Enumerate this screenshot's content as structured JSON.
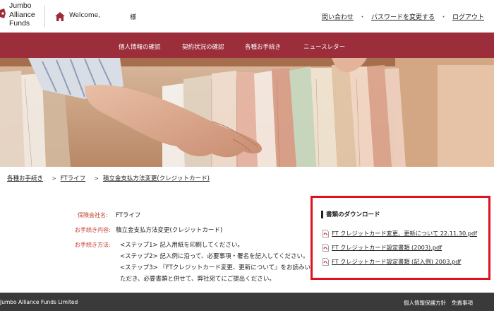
{
  "header": {
    "logo_lines": [
      "Jumbo",
      "Alliance",
      "Funds"
    ],
    "welcome": "Welcome,",
    "sama": "様",
    "links": {
      "contact": "問い合わせ",
      "password": "パスワードを変更する",
      "logout": "ログアウト",
      "separator": "・"
    }
  },
  "nav": {
    "items": [
      "個人情報の確認",
      "契約状況の確認",
      "各種お手続き",
      "ニュースレター"
    ]
  },
  "breadcrumb": {
    "items": [
      "各種お手続き",
      "FTライフ",
      "積立金支払方法変更(クレジットカード)"
    ],
    "chevron": ">"
  },
  "details": {
    "insurer_label": "保険会社名:",
    "insurer_value": "FTライフ",
    "procedure_label": "お手続き内容:",
    "procedure_value": "積立金支払方法変更(クレジットカード)",
    "method_label": "お手続き方法:",
    "method_lines": [
      "<ステップ1> 記入用紙を印刷してください。",
      "<ステップ2> 記入例に沿って、必要事項・署名を記入してください。",
      "<ステップ3> 『FTクレジットカード変更、更新について』をお読みい",
      "ただき、必要書類と併せて、弊社宛てにご提出ください。"
    ]
  },
  "downloads": {
    "title": "書類のダウンロード",
    "files": [
      "FT クレジットカード変更、更新について 22.11.30.pdf",
      "FT クレジットカード設定書類 (2003).pdf",
      "FT クレジットカード設定書類 (記入例) 2003.pdf"
    ]
  },
  "footer": {
    "copyright": "Jumbo Alliance Funds Limited",
    "links": [
      "個人情報保護方針",
      "免責事項"
    ]
  },
  "colors": {
    "brand": "#9b2e3a",
    "highlight_border": "#e0101e",
    "label_red": "#c0392b",
    "footer": "#3a3a3a"
  }
}
